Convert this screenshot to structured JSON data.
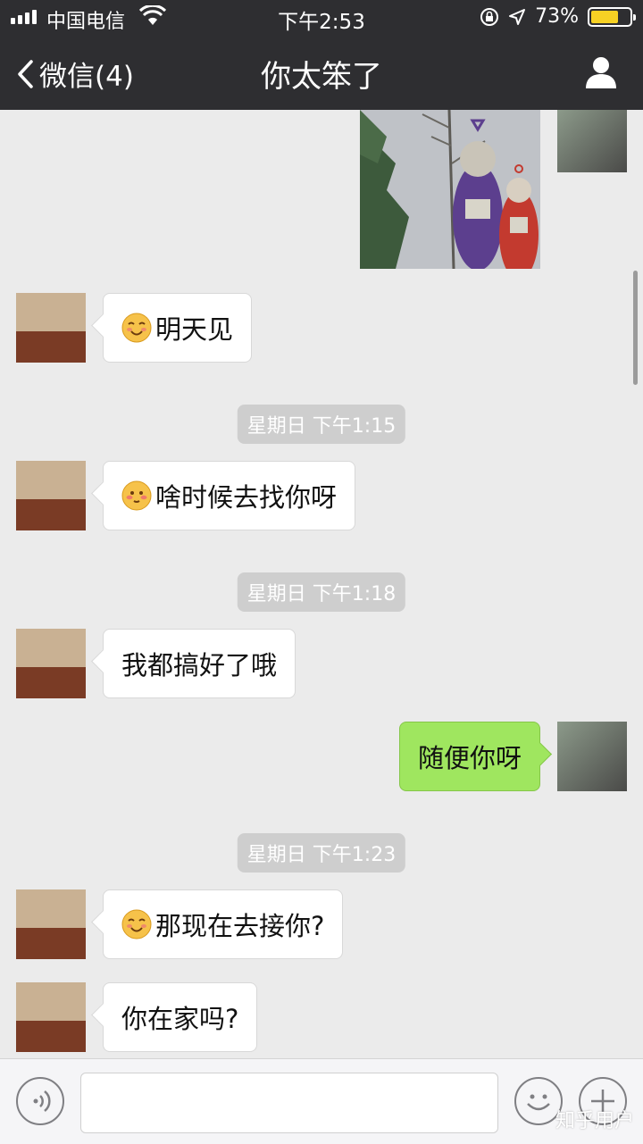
{
  "status_bar": {
    "carrier": "中国电信",
    "time": "下午2:53",
    "battery_percent": "73%",
    "icons": [
      "signal-icon",
      "wifi-icon",
      "rotation-lock-icon",
      "location-icon",
      "battery-icon"
    ]
  },
  "nav": {
    "back_label": "微信(4)",
    "title": "你太笨了",
    "icons": [
      "chevron-left-icon",
      "person-icon"
    ]
  },
  "messages": [
    {
      "side": "right",
      "kind": "image"
    },
    {
      "side": "left",
      "kind": "text",
      "emoji": "smiling-emoji-icon",
      "text": "明天见"
    },
    {
      "kind": "timestamp",
      "text": "星期日 下午1:15"
    },
    {
      "side": "left",
      "kind": "text",
      "emoji": "blushing-emoji-icon",
      "text": "啥时候去找你呀"
    },
    {
      "kind": "timestamp",
      "text": "星期日 下午1:18"
    },
    {
      "side": "left",
      "kind": "text",
      "text": "我都搞好了哦"
    },
    {
      "side": "right",
      "kind": "text",
      "text": "随便你呀"
    },
    {
      "kind": "timestamp",
      "text": "星期日 下午1:23"
    },
    {
      "side": "left",
      "kind": "text",
      "emoji": "smiling-emoji-icon",
      "text": "那现在去接你?"
    },
    {
      "side": "left",
      "kind": "text",
      "text": "你在家吗?"
    }
  ],
  "input_bar": {
    "icons": [
      "voice-icon",
      "emoji-face-icon",
      "plus-icon"
    ],
    "text_value": ""
  },
  "watermark": "知乎用户",
  "colors": {
    "nav_bg": "#2e2e31",
    "chat_bg": "#ebebeb",
    "sent_bubble": "#9fe65f",
    "received_bubble": "#ffffff",
    "timestamp_bg": "#cecece",
    "battery": "#f7d124"
  }
}
